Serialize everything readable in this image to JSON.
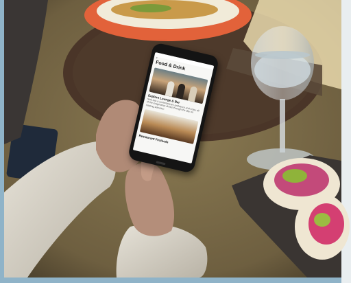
{
  "photo": {
    "description_name": "hands-holding-phone-at-restaurant-table",
    "colors": {
      "table": "#7a6a4a",
      "placemat": "#4a3528",
      "sleeve": "#d9d4c9",
      "skin": "#b08a76",
      "plate": "#e2623a",
      "tray": "#3a3532"
    }
  },
  "app": {
    "title": "Food & Drink",
    "back_label": "‹",
    "cards": [
      {
        "title": "Explore Lounge & Bar",
        "description": "Sink into a contemporary ambiance and enjoy all of the imaginative drinks through the day on rotating selection"
      },
      {
        "title": "Restaurant Festivals",
        "description": ""
      }
    ]
  }
}
